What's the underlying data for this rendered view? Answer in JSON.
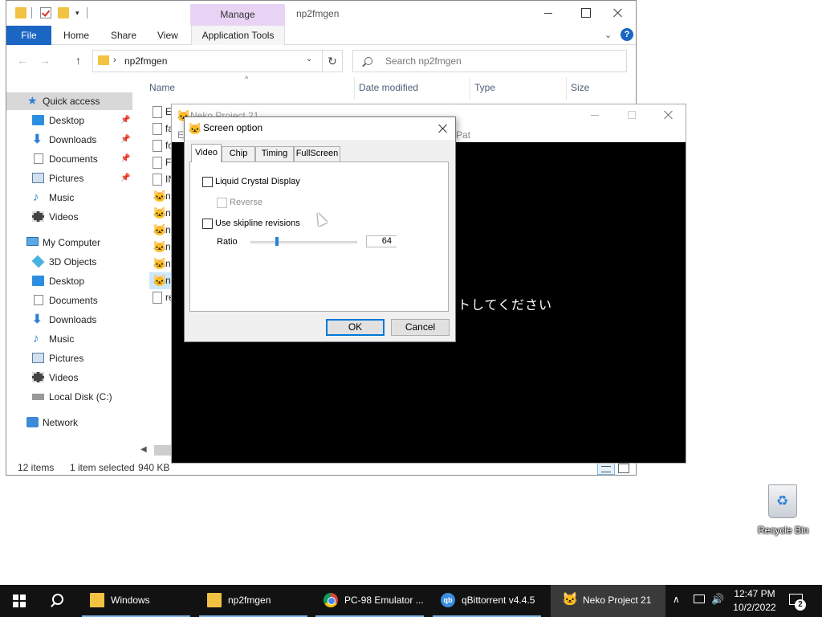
{
  "explorer": {
    "title": "np2fmgen",
    "context_tab": "Manage",
    "ribbon_tabs": {
      "file": "File",
      "home": "Home",
      "share": "Share",
      "view": "View",
      "app_tools": "Application Tools"
    },
    "address": {
      "path": "np2fmgen"
    },
    "search": {
      "placeholder": "Search np2fmgen"
    },
    "columns": {
      "name": "Name",
      "date_modified": "Date modified",
      "type": "Type",
      "size": "Size"
    },
    "nav": {
      "quick_access": "Quick access",
      "qa_items": [
        {
          "label": "Desktop",
          "icon": "desktop-icon",
          "pinned": true
        },
        {
          "label": "Downloads",
          "icon": "downloads-icon",
          "pinned": true
        },
        {
          "label": "Documents",
          "icon": "documents-icon",
          "pinned": true
        },
        {
          "label": "Pictures",
          "icon": "pictures-icon",
          "pinned": true
        },
        {
          "label": "Music",
          "icon": "music-icon",
          "pinned": false
        },
        {
          "label": "Videos",
          "icon": "videos-icon",
          "pinned": false
        }
      ],
      "my_computer": "My Computer",
      "pc_items": [
        {
          "label": "3D Objects",
          "icon": "3d-objects-icon"
        },
        {
          "label": "Desktop",
          "icon": "desktop-icon"
        },
        {
          "label": "Documents",
          "icon": "documents-icon"
        },
        {
          "label": "Downloads",
          "icon": "downloads-icon"
        },
        {
          "label": "Music",
          "icon": "music-icon"
        },
        {
          "label": "Pictures",
          "icon": "pictures-icon"
        },
        {
          "label": "Videos",
          "icon": "videos-icon"
        },
        {
          "label": "Local Disk (C:)",
          "icon": "local-disk-icon"
        }
      ],
      "network": "Network"
    },
    "files": [
      {
        "name": "E",
        "icon": "text-file-icon"
      },
      {
        "name": "fa",
        "icon": "text-file-icon"
      },
      {
        "name": "fo",
        "icon": "blank-file-icon"
      },
      {
        "name": "F",
        "icon": "text-file-icon"
      },
      {
        "name": "IN",
        "icon": "text-file-icon"
      },
      {
        "name": "n",
        "icon": "neko-app-icon"
      },
      {
        "name": "n",
        "icon": "neko-app-icon"
      },
      {
        "name": "n",
        "icon": "neko-app-icon"
      },
      {
        "name": "n",
        "icon": "neko-app-icon"
      },
      {
        "name": "n",
        "icon": "neko-app-icon"
      },
      {
        "name": "n",
        "icon": "neko-app-icon",
        "selected": true
      },
      {
        "name": "re",
        "icon": "text-file-icon"
      }
    ],
    "status": {
      "count": "12 items",
      "selected": "1 item selected",
      "size": "940 KB"
    }
  },
  "neko": {
    "title": "Neko Project 21",
    "menu_e": "E",
    "menu_pat": "Pat",
    "screen_text": "トしてください"
  },
  "dialog": {
    "title": "Screen option",
    "tabs": {
      "video": "Video",
      "chip": "Chip",
      "timing": "Timing",
      "fullscreen": "FullScreen"
    },
    "active_tab": "Video",
    "lcd_label": "Liquid Crystal Display",
    "lcd_checked": false,
    "reverse_label": "Reverse",
    "reverse_enabled": false,
    "skipline_label": "Use skipline revisions",
    "skipline_checked": false,
    "ratio_label": "Ratio",
    "ratio_value": "64",
    "ratio_slider_fraction": 0.25,
    "ok": "OK",
    "cancel": "Cancel"
  },
  "desktop": {
    "recycle_bin": "Recycle Bin"
  },
  "taskbar": {
    "items": [
      {
        "label": "Windows",
        "icon": "folder-icon",
        "underline": true
      },
      {
        "label": "np2fmgen",
        "icon": "folder-icon",
        "underline": true
      },
      {
        "label": "PC-98 Emulator ...",
        "icon": "chrome-icon",
        "underline": true
      },
      {
        "label": "qBittorrent v4.4.5",
        "icon": "qbittorrent-icon",
        "underline": true
      },
      {
        "label": "Neko Project 21",
        "icon": "neko-app-icon",
        "active": true
      }
    ],
    "qbit_icon_text": "qb",
    "time": "12:47 PM",
    "date": "10/2/2022",
    "notification_count": "2"
  },
  "colors": {
    "accent": "#0078d7",
    "file_tab": "#1a66c2",
    "manage_tab": "#e9d3f5",
    "taskbar": "#121212"
  }
}
